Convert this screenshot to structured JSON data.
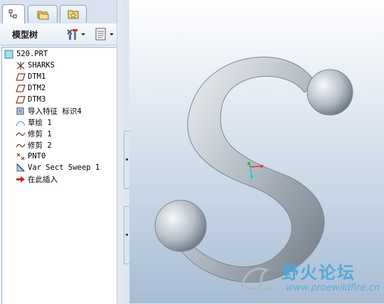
{
  "header": {
    "title": "模型树"
  },
  "tree": {
    "items": [
      {
        "label": "520.PRT",
        "icon": "part-icon"
      },
      {
        "label": "SHARKS",
        "icon": "csys-icon"
      },
      {
        "label": "DTM1",
        "icon": "datum-plane-icon"
      },
      {
        "label": "DTM2",
        "icon": "datum-plane-icon"
      },
      {
        "label": "DTM3",
        "icon": "datum-plane-icon"
      },
      {
        "label": "导入特征 标识4",
        "icon": "import-feature-icon"
      },
      {
        "label": "草绘 1",
        "icon": "sketch-icon"
      },
      {
        "label": "修剪 1",
        "icon": "curve-icon"
      },
      {
        "label": "修剪 2",
        "icon": "curve-icon"
      },
      {
        "label": "PNT0",
        "icon": "datum-point-icon"
      },
      {
        "label": "Var Sect Sweep 1",
        "icon": "sweep-icon"
      },
      {
        "label": "在此插入",
        "icon": "insert-arrow-icon"
      }
    ]
  },
  "watermark": {
    "zh": "野火论坛",
    "url": "www.proewildfire.cn"
  }
}
